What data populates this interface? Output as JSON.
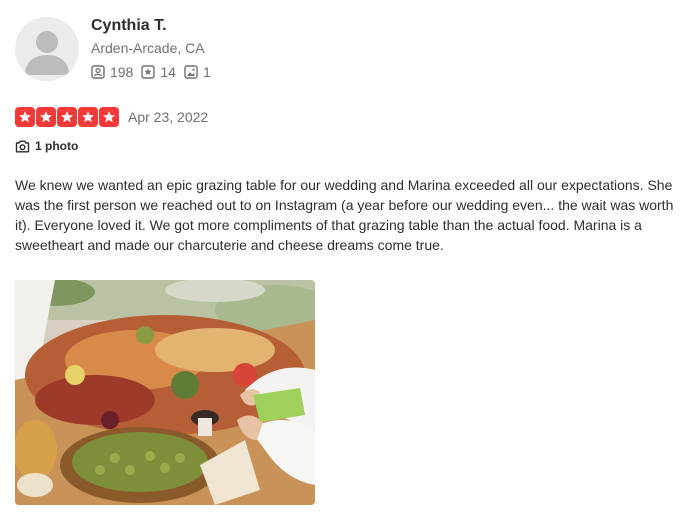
{
  "user": {
    "name": "Cynthia T.",
    "location": "Arden-Arcade, CA",
    "friends_count": "198",
    "reviews_count": "14",
    "photos_count": "1"
  },
  "review": {
    "rating": 5,
    "date": "Apr 23, 2022",
    "photo_label": "1 photo",
    "text": "We knew we wanted an epic grazing table for our wedding and Marina exceeded all our expectations. She was the first person we reached out to on Instagram (a year before our wedding even... the wait was worth it). Everyone loved it. We got more compliments of that grazing table than the actual food. Marina is a sweetheart and made our charcuterie and cheese dreams come true."
  },
  "colors": {
    "star": "#f43939",
    "muted_text": "#6e7072",
    "body_text": "#2d2e2f"
  },
  "icons": {
    "friends": "friends-icon",
    "reviews": "star-review-icon",
    "photos": "photo-icon",
    "camera": "camera-icon"
  }
}
